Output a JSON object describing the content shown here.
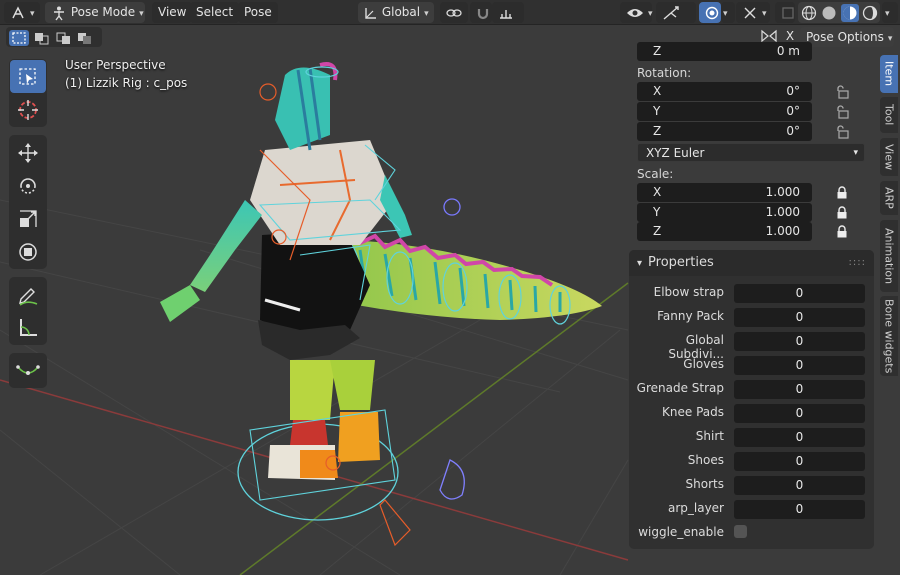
{
  "header": {
    "mode": "Pose Mode",
    "menus": [
      "View",
      "Select",
      "Pose"
    ],
    "transform_orientation": "Global",
    "pose_options_label": "Pose Options",
    "x_mirror_label": "X"
  },
  "overlay": {
    "perspective": "User Perspective",
    "active_object": "(1) Lizzik Rig : c_pos"
  },
  "transform": {
    "loc_z_label": "Z",
    "loc_z_value": "0 m",
    "rotation_label": "Rotation:",
    "rotation": [
      {
        "axis": "X",
        "value": "0°"
      },
      {
        "axis": "Y",
        "value": "0°"
      },
      {
        "axis": "Z",
        "value": "0°"
      }
    ],
    "rotation_mode": "XYZ Euler",
    "scale_label": "Scale:",
    "scale": [
      {
        "axis": "X",
        "value": "1.000"
      },
      {
        "axis": "Y",
        "value": "1.000"
      },
      {
        "axis": "Z",
        "value": "1.000"
      }
    ]
  },
  "properties": {
    "title": "Properties",
    "items": [
      {
        "label": "Elbow strap",
        "value": "0"
      },
      {
        "label": "Fanny Pack",
        "value": "0"
      },
      {
        "label": "Global Subdivi...",
        "value": "0"
      },
      {
        "label": "Gloves",
        "value": "0"
      },
      {
        "label": "Grenade Strap",
        "value": "0"
      },
      {
        "label": "Knee Pads",
        "value": "0"
      },
      {
        "label": "Shirt",
        "value": "0"
      },
      {
        "label": "Shoes",
        "value": "0"
      },
      {
        "label": "Shorts",
        "value": "0"
      },
      {
        "label": "arp_layer",
        "value": "0"
      }
    ],
    "checkbox_label": "wiggle_enable"
  },
  "tabs": [
    "Item",
    "Tool",
    "View",
    "ARP",
    "Animation",
    "Bone widgets"
  ],
  "colors": {
    "accent": "#4772b3",
    "field": "#1d1d1d",
    "panel": "#303030"
  }
}
